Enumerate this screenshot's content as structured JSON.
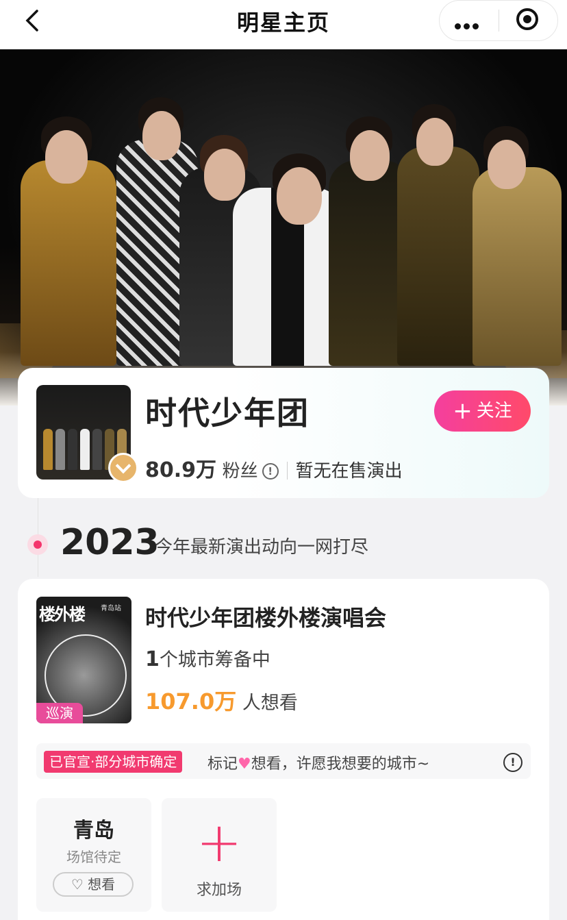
{
  "header": {
    "title": "明星主页",
    "back_icon": "chevron-left-icon",
    "more_icon": "more-dots-icon",
    "close_icon": "target-close-icon"
  },
  "artist": {
    "name": "时代少年团",
    "fans_count": "80.9万",
    "fans_label": "粉丝",
    "on_sale_status": "暂无在售演出",
    "follow_label": "关注",
    "follow_plus": "+",
    "accent_color": "#f43f9e"
  },
  "timeline": {
    "year": "2023",
    "description": "今年最新演出动向一网打尽"
  },
  "tour": {
    "poster_title": "楼外楼",
    "poster_location": "青岛站",
    "tag": "巡演",
    "title": "时代少年团楼外楼演唱会",
    "cities_count": "1",
    "cities_text": "个城市筹备中",
    "want_count": "107.0万",
    "want_text": "人想看",
    "notice_badge": "已官宣·部分城市确定",
    "notice_text_before": "标记",
    "notice_heart": "♥",
    "notice_text_after": "想看，许愿我想要的城市~",
    "notice_info": "!",
    "city": {
      "name": "青岛",
      "venue": "场馆待定",
      "want_label": "想看"
    },
    "add_tile": {
      "plus": "+",
      "label": "求加场"
    }
  }
}
